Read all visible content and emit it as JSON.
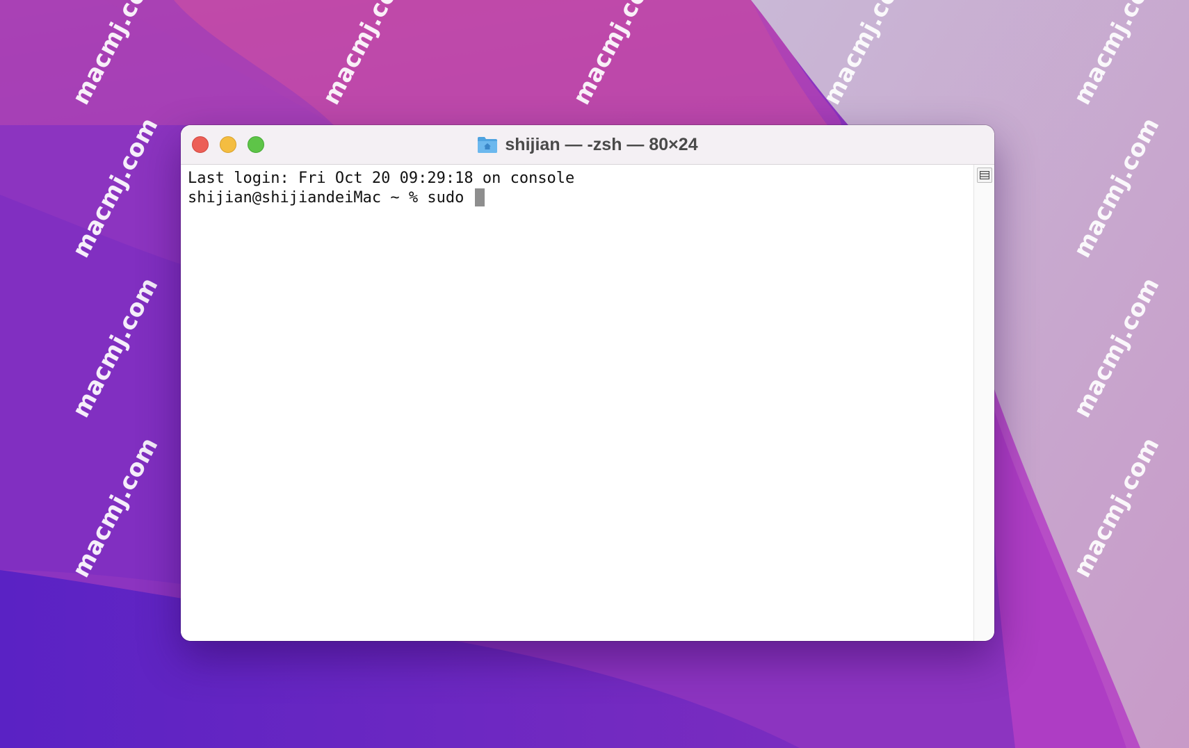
{
  "window": {
    "title": "shijian — -zsh — 80×24",
    "title_icon": "home-folder-icon"
  },
  "terminal": {
    "lines": [
      "Last login: Fri Oct 20 09:29:18 on console",
      "shijian@shijiandeiMac ~ % sudo "
    ]
  },
  "watermark": {
    "text": "macmj.com"
  },
  "colors": {
    "close": "#ec5f57",
    "minimize": "#f4bd41",
    "zoom": "#5ec448",
    "cursor": "#8e8e8e",
    "titlebar": "#f4f0f4"
  }
}
